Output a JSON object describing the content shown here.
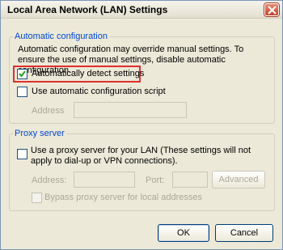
{
  "window": {
    "title": "Local Area Network (LAN) Settings"
  },
  "automatic_configuration": {
    "legend": "Automatic configuration",
    "description": "Automatic configuration may override manual settings.  To ensure the use of manual settings, disable automatic configuration.",
    "auto_detect": {
      "label": "Automatically detect settings",
      "checked": true
    },
    "use_script": {
      "label": "Use automatic configuration script",
      "checked": false
    },
    "address": {
      "label": "Address",
      "value": ""
    }
  },
  "proxy_server": {
    "legend": "Proxy server",
    "use_proxy": {
      "label": "Use a proxy server for your LAN (These settings will not apply to dial-up or VPN connections).",
      "checked": false
    },
    "address": {
      "label": "Address:",
      "value": ""
    },
    "port": {
      "label": "Port:",
      "value": ""
    },
    "advanced_button": "Advanced",
    "bypass": {
      "label": "Bypass proxy server for local addresses",
      "checked": false
    }
  },
  "buttons": {
    "ok": "OK",
    "cancel": "Cancel"
  }
}
